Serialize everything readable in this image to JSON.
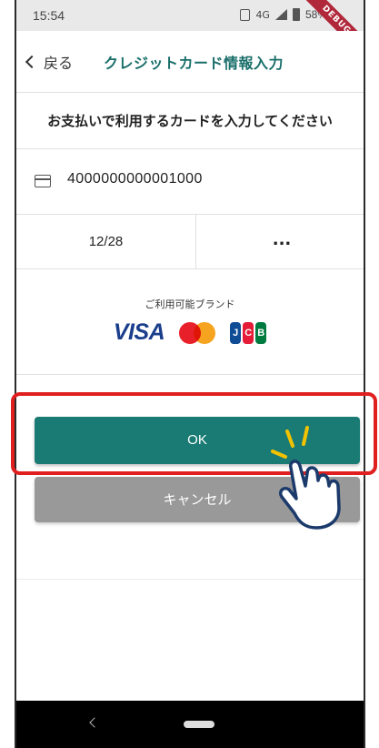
{
  "status_bar": {
    "time": "15:54",
    "network": "4G",
    "battery": "58%",
    "debug_label": "DEBUG"
  },
  "header": {
    "back_label": "戻る",
    "title": "クレジットカード情報入力"
  },
  "form": {
    "instruction": "お支払いで利用するカードを入力してください",
    "card_number": "4000000000001000",
    "expiry": "12/28",
    "cvc": "..."
  },
  "brands": {
    "label": "ご利用可能ブランド",
    "visa": "VISA",
    "jcb_letters": [
      "J",
      "C",
      "B"
    ]
  },
  "actions": {
    "ok_label": "OK",
    "cancel_label": "キャンセル"
  },
  "colors": {
    "accent": "#1a7b74",
    "title": "#1a6f6b",
    "highlight": "#e01f1f",
    "cancel": "#999999"
  },
  "icons": [
    "card-icon",
    "back-chevron-icon",
    "hand-pointer-icon",
    "nav-back-icon",
    "nav-home-icon"
  ]
}
